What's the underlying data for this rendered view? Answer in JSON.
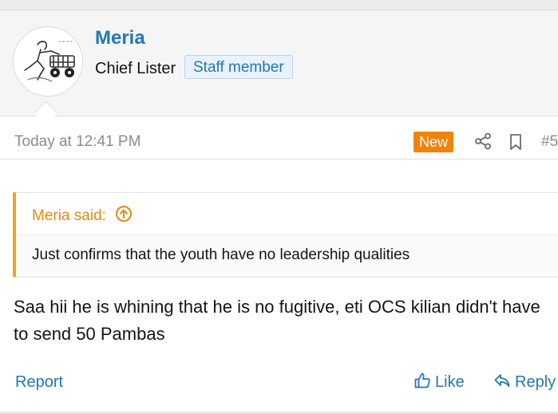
{
  "user": {
    "name": "Meria",
    "title": "Chief Lister",
    "badge": "Staff member"
  },
  "post": {
    "date": "Today at 12:41 PM",
    "new_badge": "New",
    "number": "#5"
  },
  "quote": {
    "author": "Meria said:",
    "text": "Just confirms that the youth have no leadership qualities"
  },
  "message": {
    "text": "Saa hii he is whining that he is no fugitive, eti OCS kilian didn't have to send 50 Pambas"
  },
  "actions": {
    "report": "Report",
    "like": "Like",
    "reply": "Reply"
  },
  "icons": {
    "share": "share-icon",
    "bookmark": "bookmark-icon",
    "quote_up": "arrow-up-circle-icon",
    "like": "thumbs-up-icon",
    "reply": "reply-arrow-icon"
  },
  "colors": {
    "link": "#2577b1",
    "new_badge": "#f0830e",
    "quote_accent": "#f0a31f"
  }
}
